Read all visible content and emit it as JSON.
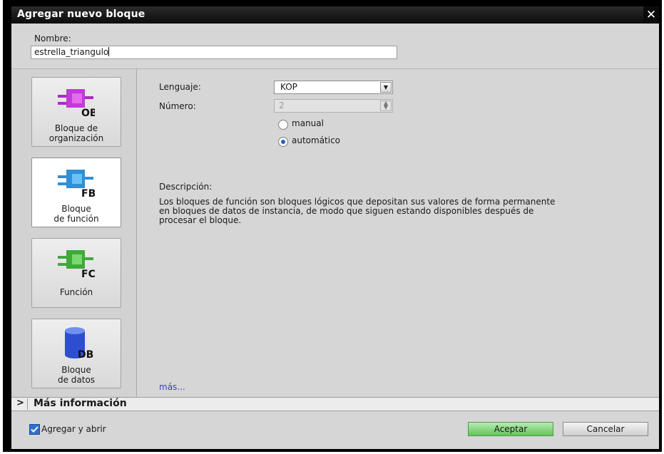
{
  "dialog": {
    "title": "Agregar nuevo bloque",
    "close_glyph": "✕"
  },
  "name": {
    "label": "Nombre:",
    "value": "estrella_triangulo"
  },
  "block_types": [
    {
      "code": "OB",
      "caption_line1": "Bloque de",
      "caption_line2": "organización",
      "color": "#b028c8"
    },
    {
      "code": "FB",
      "caption_line1": "Bloque",
      "caption_line2": "de función",
      "color": "#2f8fd8"
    },
    {
      "code": "FC",
      "caption_line1": "",
      "caption_line2": "Función",
      "color": "#3faa3a"
    },
    {
      "code": "DB",
      "caption_line1": "Bloque",
      "caption_line2": "de datos",
      "color": "#2d4fcf"
    }
  ],
  "selected_block": "FB",
  "language": {
    "label": "Lenguaje:",
    "value": "KOP",
    "arrow": "▼"
  },
  "number": {
    "label": "Número:",
    "value": "2",
    "spin": "▲▼"
  },
  "numbering": {
    "manual_label": "manual",
    "auto_label": "automático",
    "selected": "automático"
  },
  "description": {
    "label": "Descripción:",
    "line1": "Los bloques de función son bloques lógicos que depositan sus valores de forma permanente",
    "line2": "en bloques de datos de instancia, de modo que siguen estando disponibles después de",
    "line3": "procesar el bloque."
  },
  "more_link": "más...",
  "more_info": {
    "chevron": ">",
    "label": "Más información"
  },
  "add_and_open": {
    "label": "Agregar y abrir",
    "checked": true
  },
  "buttons": {
    "ok": "Aceptar",
    "cancel": "Cancelar"
  },
  "colors": {
    "accent_ok": "#62c45a",
    "title_bar": "#111111",
    "selection_blue": "#2463b5"
  }
}
